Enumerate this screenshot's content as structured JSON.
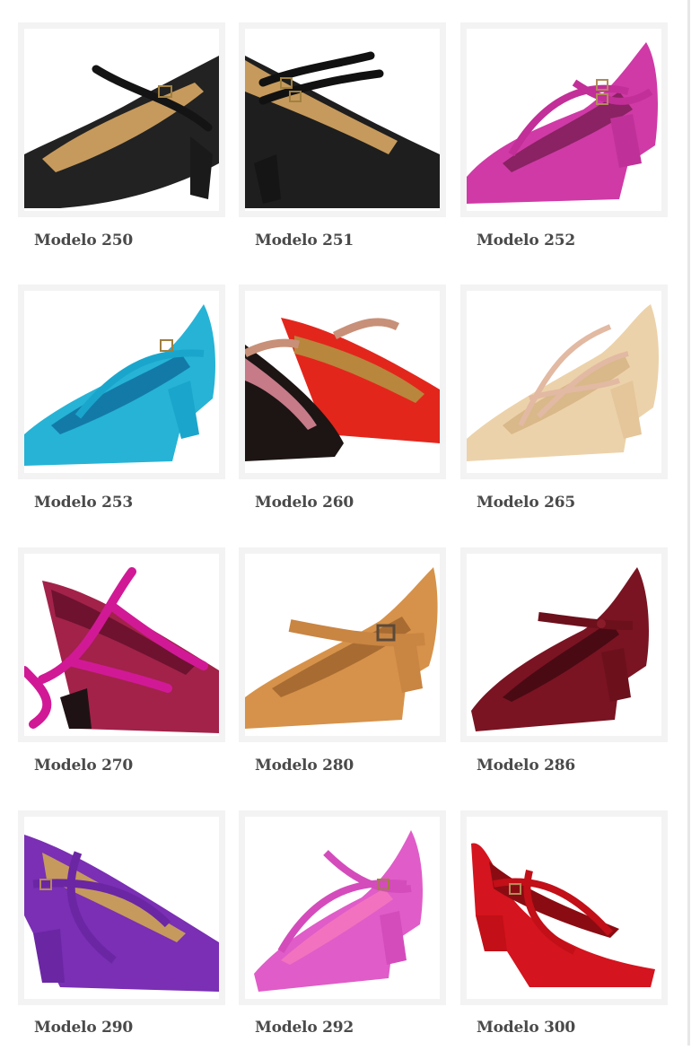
{
  "products": [
    {
      "label": "Modelo 250",
      "icon": "black-leather-strap-shoe-image",
      "color": "#1e1e1e",
      "strap": "#161616"
    },
    {
      "label": "Modelo 251",
      "icon": "black-double-strap-shoe-image",
      "color": "#1a1a1a",
      "strap": "#121212"
    },
    {
      "label": "Modelo 252",
      "icon": "magenta-suede-cross-strap-shoe-image",
      "color": "#cf3aa6",
      "strap": "#c22f98"
    },
    {
      "label": "Modelo 253",
      "icon": "turquoise-strap-shoe-image",
      "color": "#26b3d6",
      "strap": "#1aa6cc"
    },
    {
      "label": "Modelo 260",
      "icon": "red-and-black-strap-shoes-image",
      "color": "#e3261c",
      "strap": "#c89078"
    },
    {
      "label": "Modelo 265",
      "icon": "beige-ribbon-shoe-image",
      "color": "#ecd2aa",
      "strap": "#e2b9a2"
    },
    {
      "label": "Modelo 270",
      "icon": "burgundy-ribbon-shoe-image",
      "color": "#a2224a",
      "strap": "#d11996"
    },
    {
      "label": "Modelo 280",
      "icon": "tan-strap-shoe-image",
      "color": "#d6924a",
      "strap": "#c98542"
    },
    {
      "label": "Modelo 286",
      "icon": "burgundy-strap-shoe-image",
      "color": "#7a1422",
      "strap": "#6c101c"
    },
    {
      "label": "Modelo 290",
      "icon": "purple-suede-cross-strap-shoe-image",
      "color": "#7a2fb4",
      "strap": "#6b26a4"
    },
    {
      "label": "Modelo 292",
      "icon": "pink-suede-cross-strap-shoe-image",
      "color": "#e05cc8",
      "strap": "#d44cbc"
    },
    {
      "label": "Modelo 300",
      "icon": "red-suede-cross-strap-shoe-image",
      "color": "#d4141e",
      "strap": "#c20f18"
    }
  ]
}
